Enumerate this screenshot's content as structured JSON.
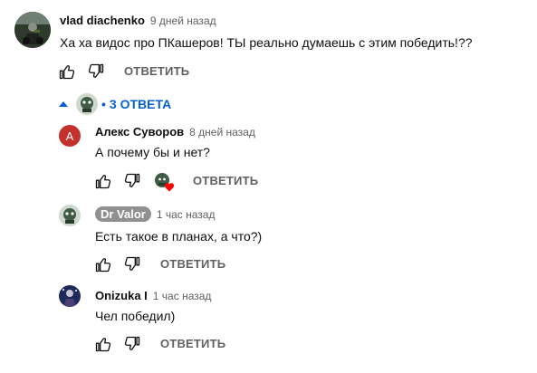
{
  "comment": {
    "author": "vlad diachenko",
    "time": "9 дней назад",
    "text": "Ха ха видос про ПКашеров! ТЫ реально думаешь с этим победить!??",
    "reply_label": "ОТВЕТИТЬ"
  },
  "replies_toggle": {
    "dot": "•",
    "label": "3 ОТВЕТА"
  },
  "replies": [
    {
      "author": "Алекс Суворов",
      "time": "8 дней назад",
      "text": "А почему бы  и нет?",
      "reply_label": "ОТВЕТИТЬ",
      "avatar_letter": "А",
      "avatar_color": "#c4302b",
      "hearted": true
    },
    {
      "author": "Dr Valor",
      "time": "1 час назад",
      "text": "Есть такое в планах, а что?)",
      "reply_label": "ОТВЕТИТЬ"
    },
    {
      "author": "Onizuka I",
      "time": "1 час назад",
      "text": "Чел победил)",
      "reply_label": "ОТВЕТИТЬ"
    }
  ],
  "colors": {
    "link_blue": "#065fd4",
    "meta_gray": "#606060",
    "chip_gray": "#909090",
    "heart_red": "#ff0000"
  },
  "icons": {
    "like": "thumb-up-icon",
    "dislike": "thumb-down-icon",
    "toggle": "caret-up-icon",
    "heart": "heart-icon"
  }
}
